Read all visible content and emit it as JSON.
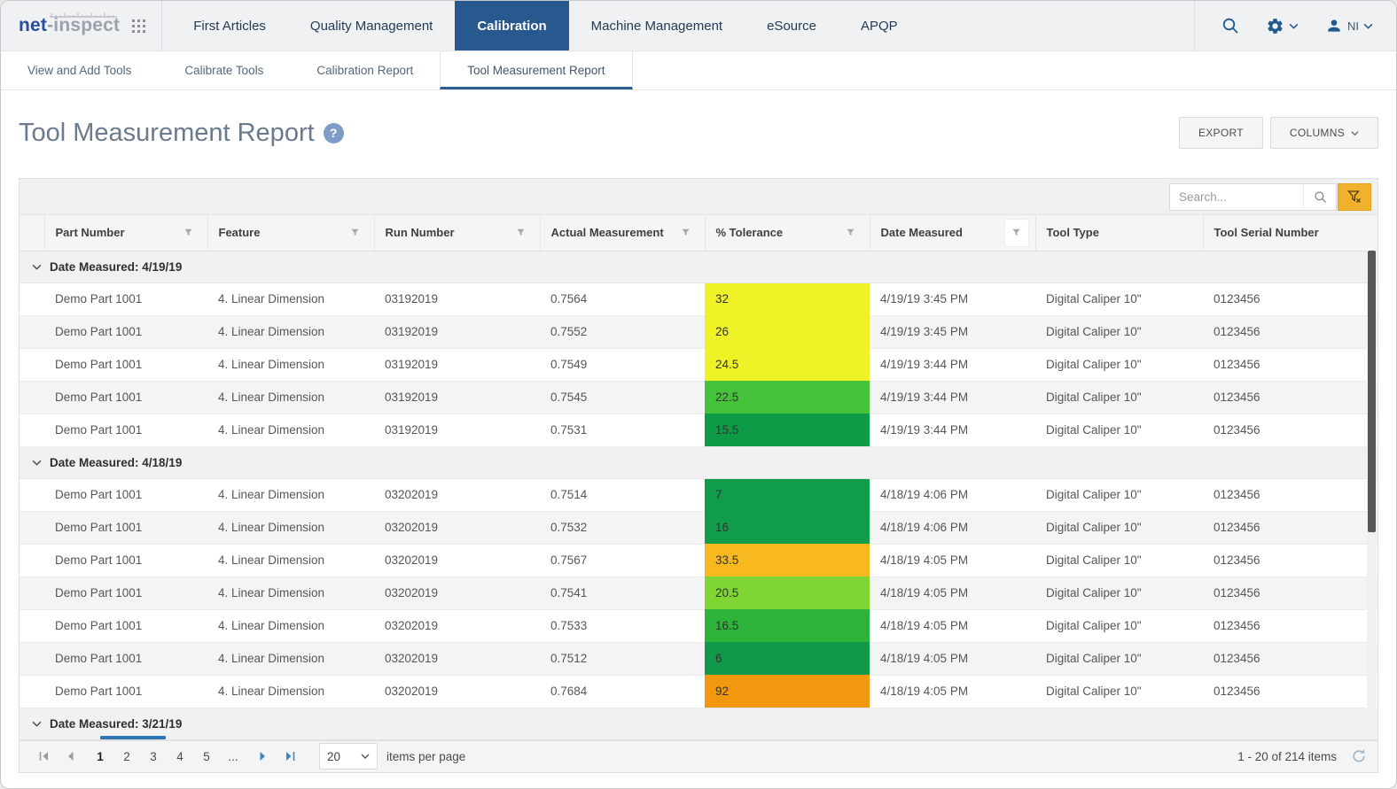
{
  "topnav": {
    "brand_net": "net",
    "brand_inspect": "-inspect",
    "items": [
      {
        "label": "First Articles",
        "active": false
      },
      {
        "label": "Quality Management",
        "active": false
      },
      {
        "label": "Calibration",
        "active": true
      },
      {
        "label": "Machine Management",
        "active": false
      },
      {
        "label": "eSource",
        "active": false
      },
      {
        "label": "APQP",
        "active": false
      }
    ],
    "user_initials": "NI",
    "icons": [
      "search-icon",
      "gear-icon",
      "user-icon"
    ]
  },
  "subtabs": [
    {
      "label": "View and Add Tools",
      "active": false
    },
    {
      "label": "Calibrate Tools",
      "active": false
    },
    {
      "label": "Calibration Report",
      "active": false
    },
    {
      "label": "Tool Measurement Report",
      "active": true
    }
  ],
  "page": {
    "title": "Tool Measurement Report",
    "export_label": "EXPORT",
    "columns_label": "COLUMNS"
  },
  "toolbar": {
    "search_placeholder": "Search...",
    "filter_clear_color": "#f0b12d"
  },
  "table": {
    "columns": [
      {
        "label": "",
        "slug": "gutter",
        "filter": false
      },
      {
        "label": "Part Number",
        "slug": "part-number",
        "filter": true
      },
      {
        "label": "Feature",
        "slug": "feature",
        "filter": true
      },
      {
        "label": "Run Number",
        "slug": "run-number",
        "filter": true
      },
      {
        "label": "Actual Measurement",
        "slug": "actual-measurement",
        "filter": true
      },
      {
        "label": "% Tolerance",
        "slug": "tolerance",
        "filter": true
      },
      {
        "label": "Date Measured",
        "slug": "date-measured",
        "filter": true,
        "filter_active": true
      },
      {
        "label": "Tool Type",
        "slug": "tool-type",
        "filter": false
      },
      {
        "label": "Tool Serial Number",
        "slug": "tool-serial-number",
        "filter": false
      }
    ],
    "groups": [
      {
        "label": "Date Measured: 4/19/19",
        "rows": [
          {
            "part": "Demo Part 1001",
            "feature": "4. Linear Dimension",
            "run": "03192019",
            "actual": "0.7564",
            "tolerance": "32",
            "tolerance_color": "#eff227",
            "date": "4/19/19 3:45 PM",
            "tool_type": "Digital Caliper 10\"",
            "serial": "0123456"
          },
          {
            "part": "Demo Part 1001",
            "feature": "4. Linear Dimension",
            "run": "03192019",
            "actual": "0.7552",
            "tolerance": "26",
            "tolerance_color": "#eff227",
            "date": "4/19/19 3:45 PM",
            "tool_type": "Digital Caliper 10\"",
            "serial": "0123456"
          },
          {
            "part": "Demo Part 1001",
            "feature": "4. Linear Dimension",
            "run": "03192019",
            "actual": "0.7549",
            "tolerance": "24.5",
            "tolerance_color": "#eff227",
            "date": "4/19/19 3:44 PM",
            "tool_type": "Digital Caliper 10\"",
            "serial": "0123456"
          },
          {
            "part": "Demo Part 1001",
            "feature": "4. Linear Dimension",
            "run": "03192019",
            "actual": "0.7545",
            "tolerance": "22.5",
            "tolerance_color": "#45c23a",
            "date": "4/19/19 3:44 PM",
            "tool_type": "Digital Caliper 10\"",
            "serial": "0123456"
          },
          {
            "part": "Demo Part 1001",
            "feature": "4. Linear Dimension",
            "run": "03192019",
            "actual": "0.7531",
            "tolerance": "15.5",
            "tolerance_color": "#0e9b48",
            "date": "4/19/19 3:44 PM",
            "tool_type": "Digital Caliper 10\"",
            "serial": "0123456"
          }
        ]
      },
      {
        "label": "Date Measured: 4/18/19",
        "rows": [
          {
            "part": "Demo Part 1001",
            "feature": "4. Linear Dimension",
            "run": "03202019",
            "actual": "0.7514",
            "tolerance": "7",
            "tolerance_color": "#119c4b",
            "date": "4/18/19 4:06 PM",
            "tool_type": "Digital Caliper 10\"",
            "serial": "0123456"
          },
          {
            "part": "Demo Part 1001",
            "feature": "4. Linear Dimension",
            "run": "03202019",
            "actual": "0.7532",
            "tolerance": "16",
            "tolerance_color": "#119c4b",
            "date": "4/18/19 4:06 PM",
            "tool_type": "Digital Caliper 10\"",
            "serial": "0123456"
          },
          {
            "part": "Demo Part 1001",
            "feature": "4. Linear Dimension",
            "run": "03202019",
            "actual": "0.7567",
            "tolerance": "33.5",
            "tolerance_color": "#f7b820",
            "date": "4/18/19 4:05 PM",
            "tool_type": "Digital Caliper 10\"",
            "serial": "0123456"
          },
          {
            "part": "Demo Part 1001",
            "feature": "4. Linear Dimension",
            "run": "03202019",
            "actual": "0.7541",
            "tolerance": "20.5",
            "tolerance_color": "#7fd532",
            "date": "4/18/19 4:05 PM",
            "tool_type": "Digital Caliper 10\"",
            "serial": "0123456"
          },
          {
            "part": "Demo Part 1001",
            "feature": "4. Linear Dimension",
            "run": "03202019",
            "actual": "0.7533",
            "tolerance": "16.5",
            "tolerance_color": "#2db33a",
            "date": "4/18/19 4:05 PM",
            "tool_type": "Digital Caliper 10\"",
            "serial": "0123456"
          },
          {
            "part": "Demo Part 1001",
            "feature": "4. Linear Dimension",
            "run": "03202019",
            "actual": "0.7512",
            "tolerance": "6",
            "tolerance_color": "#12984a",
            "date": "4/18/19 4:05 PM",
            "tool_type": "Digital Caliper 10\"",
            "serial": "0123456"
          },
          {
            "part": "Demo Part 1001",
            "feature": "4. Linear Dimension",
            "run": "03202019",
            "actual": "0.7684",
            "tolerance": "92",
            "tolerance_color": "#f1980f",
            "date": "4/18/19 4:05 PM",
            "tool_type": "Digital Caliper 10\"",
            "serial": "0123456"
          }
        ]
      },
      {
        "label": "Date Measured: 3/21/19",
        "underline": true,
        "rows": []
      }
    ]
  },
  "pager": {
    "pages": [
      "1",
      "2",
      "3",
      "4",
      "5"
    ],
    "current": "1",
    "ellipsis": "...",
    "page_size": "20",
    "items_per_page_label": "items per page",
    "range_label": "1 - 20 of 214 items"
  }
}
